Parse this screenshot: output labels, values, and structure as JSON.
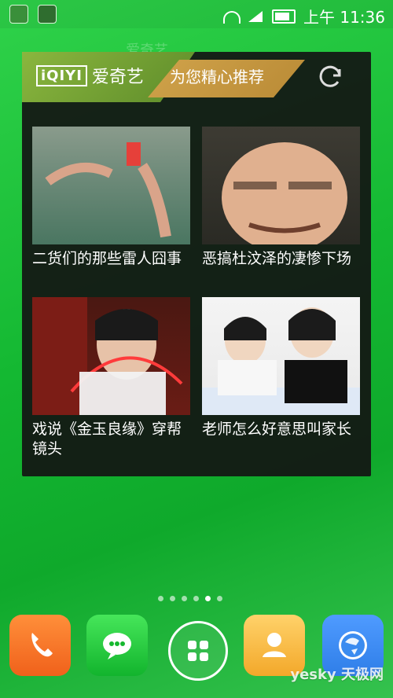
{
  "status_bar": {
    "time": "上午 11:36"
  },
  "background": {
    "faint_logo_text": "爱奇艺"
  },
  "widget": {
    "brand_logo": "iQIYI",
    "brand_name": "爱奇艺",
    "recommend_label": "为您精心推荐",
    "refresh_icon": "refresh-icon",
    "items": [
      {
        "title": "二货们的那些雷人囧事"
      },
      {
        "title": "恶搞杜汶泽的凄惨下场"
      },
      {
        "title": "戏说《金玉良缘》穿帮镜头"
      },
      {
        "title": "老师怎么好意思叫家长"
      }
    ]
  },
  "page_indicator": {
    "count": 6,
    "active_index": 4
  },
  "dock": {
    "items": [
      {
        "icon": "phone-icon"
      },
      {
        "icon": "message-icon"
      },
      {
        "icon": "app-drawer-icon"
      },
      {
        "icon": "contacts-icon"
      },
      {
        "icon": "browser-icon"
      }
    ]
  },
  "watermark": "yesky 天极网"
}
